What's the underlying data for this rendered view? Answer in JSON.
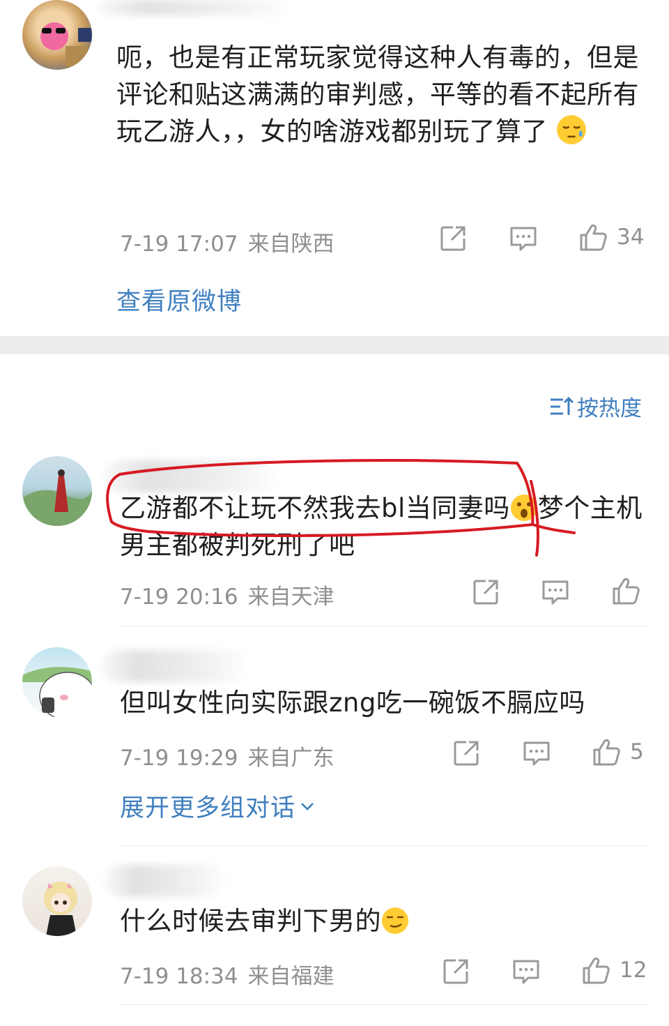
{
  "comments_top": {
    "text": "呃，也是有正常玩家觉得这种人有毒的，但是评论和贴这满满的审判感，平等的看不起所有玩乙游人，，女的啥游戏都别玩了算了",
    "time": "7-19 17:07",
    "location": "来自陕西",
    "likes": "34",
    "view_original": "查看原微博"
  },
  "sort_label": "按热度",
  "comments": [
    {
      "text": "乙游都不让玩不然我去bl当同妻吗",
      "text_after": "梦个主机男主都被判死刑了吧",
      "time": "7-19 20:16",
      "location": "来自天津",
      "likes": ""
    },
    {
      "text": "但叫女性向实际跟zng吃一碗饭不膈应吗",
      "time": "7-19 19:29",
      "location": "来自广东",
      "likes": "5",
      "expand": "展开更多组对话"
    },
    {
      "text": "什么时候去审判下男的",
      "time": "7-19 18:34",
      "location": "来自福建",
      "likes": "12"
    }
  ],
  "icons": [
    "share-icon",
    "comment-icon",
    "like-icon",
    "sort-icon",
    "chevron-down-icon"
  ],
  "colors": {
    "link": "#3f7fbf",
    "meta": "#8f8f8f",
    "annotation": "#d71a22",
    "separator": "#ececec"
  }
}
